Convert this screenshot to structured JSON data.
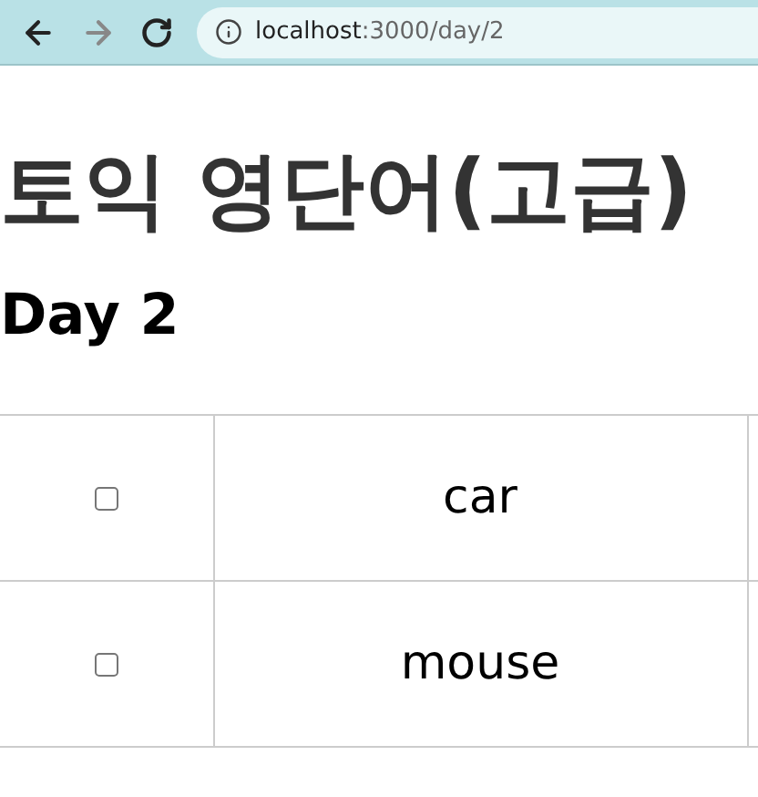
{
  "browser": {
    "url_host": "localhost",
    "url_path": ":3000/day/2"
  },
  "title": "토익 영단어(고급)",
  "subtitle": "Day 2",
  "words": [
    {
      "checked": false,
      "word": "car"
    },
    {
      "checked": false,
      "word": "mouse"
    }
  ]
}
